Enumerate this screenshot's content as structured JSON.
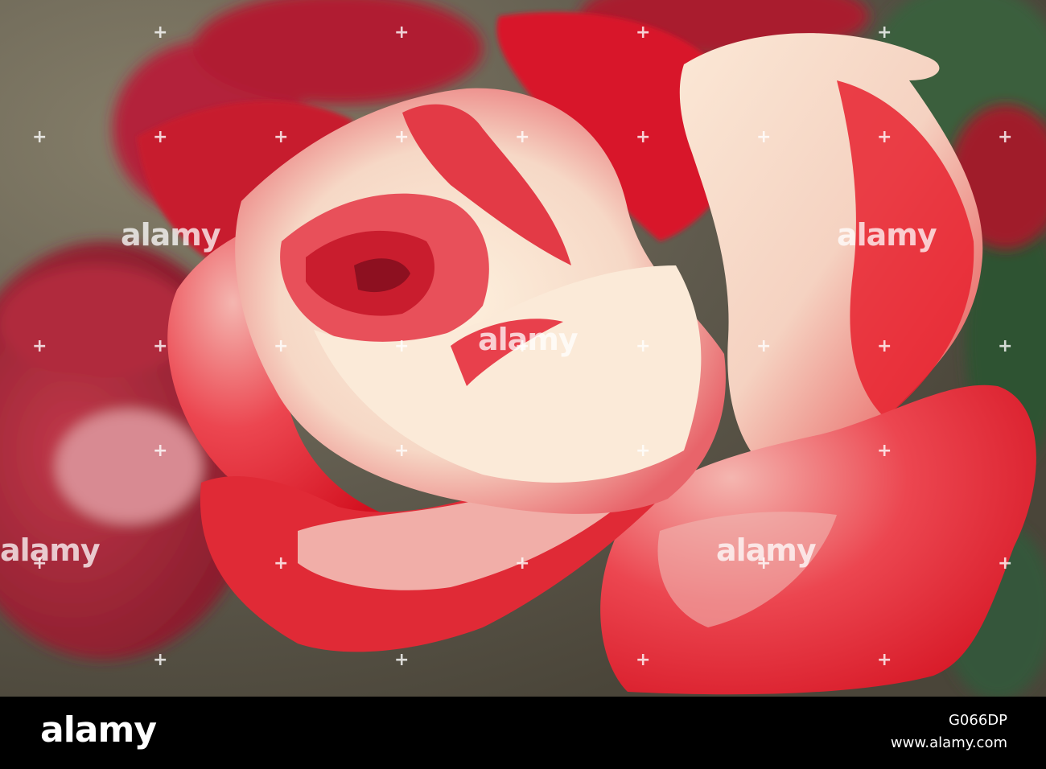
{
  "photo": {
    "subject": "rose-flower",
    "colors": {
      "petal_red": "#e2182a",
      "petal_cream": "#f7e1c8",
      "background": "#6f6a5c",
      "leaf_green": "#3c6a40"
    }
  },
  "watermarks": [
    "alamy",
    "alamy",
    "alamy",
    "alamy",
    "alamy"
  ],
  "footer": {
    "logo": "alamy",
    "image_id": "G066DP",
    "url": "www.alamy.com"
  }
}
